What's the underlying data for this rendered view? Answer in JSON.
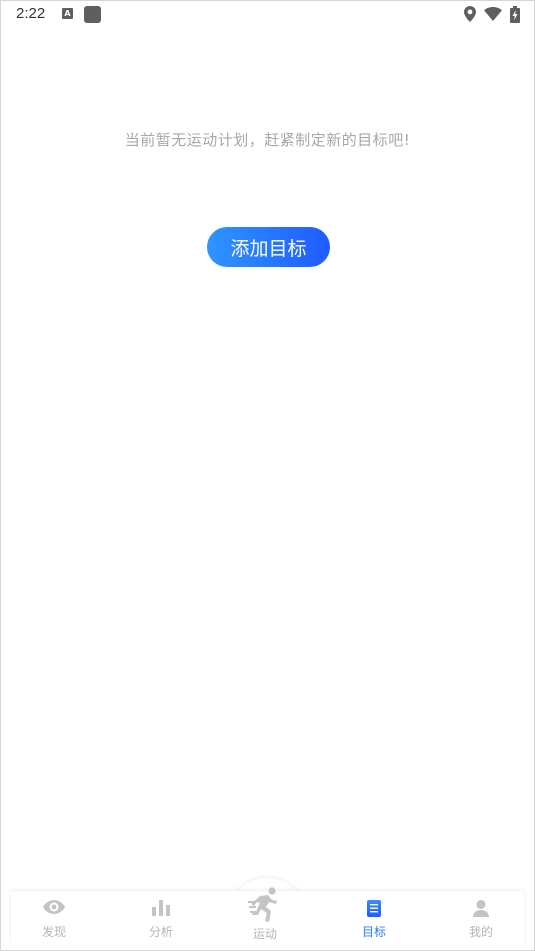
{
  "status_bar": {
    "time": "2:22",
    "a_icon_text": "A"
  },
  "empty_state": {
    "message": "当前暂无运动计划，赶紧制定新的目标吧!",
    "add_button_label": "添加目标"
  },
  "bottom_nav": {
    "items": [
      {
        "label": "发现",
        "icon": "eye-icon",
        "active": false
      },
      {
        "label": "分析",
        "icon": "bar-chart-icon",
        "active": false
      },
      {
        "label": "运动",
        "icon": "running-person-icon",
        "active": false
      },
      {
        "label": "目标",
        "icon": "document-icon",
        "active": true
      },
      {
        "label": "我的",
        "icon": "person-icon",
        "active": false
      }
    ]
  },
  "colors": {
    "accent": "#2a7cf8",
    "button_gradient_start": "#2f95ff",
    "button_gradient_end": "#1f5bff",
    "inactive": "#b5b5b5",
    "message_text": "#a8a8a8"
  }
}
